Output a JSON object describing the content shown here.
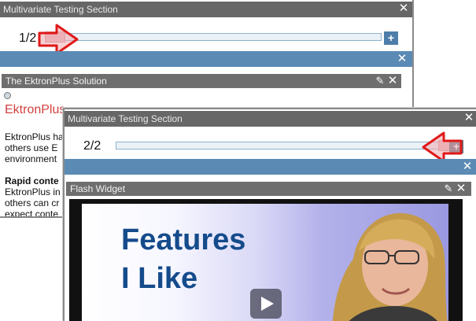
{
  "back_panel": {
    "title": "Multivariate Testing Section",
    "counter": "1/2",
    "plus_label": "+",
    "widget_title": "The EktronPlus Solution",
    "brand_text": "EktronPlus",
    "body_lines": [
      "EktronPlus ha",
      "others use E",
      "environment"
    ],
    "bold_heading": "Rapid conte",
    "body_lines_2": [
      "EktronPlus in",
      "others can cr",
      "expect conte"
    ]
  },
  "front_panel": {
    "title": "Multivariate Testing Section",
    "counter": "2/2",
    "plus_label": "+",
    "widget_title": "Flash Widget",
    "video_text_line1": "Features",
    "video_text_line2": "I Like"
  },
  "icons": {
    "close": "close-icon",
    "edit": "pencil-icon",
    "pointer": "red-arrow-pointer-icon",
    "play": "play-icon"
  },
  "colors": {
    "title_bar": "#676767",
    "blue_bar": "#5b8bb5",
    "brand_red": "#d24040",
    "pointer_red": "#e01919"
  }
}
